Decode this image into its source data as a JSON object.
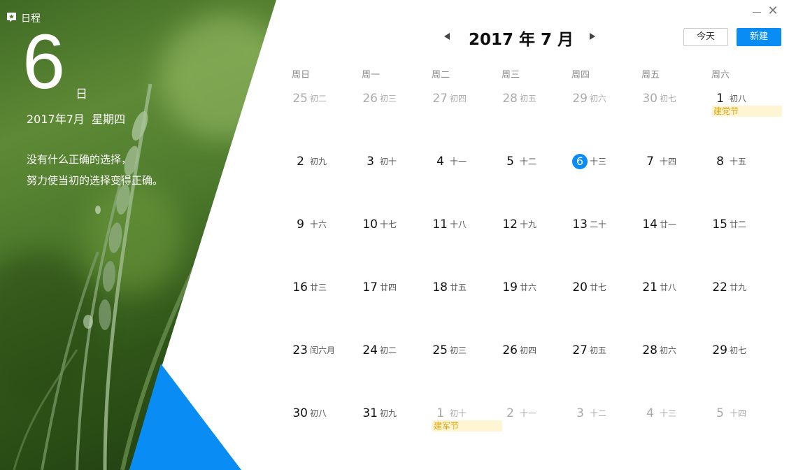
{
  "app": {
    "name": "日程",
    "logo_icon": "calendar-star-icon"
  },
  "sidebar": {
    "day": "6",
    "day_suffix": "日",
    "full_date": "2017年7月  星期四",
    "quote_line1": "没有什么正确的选择，",
    "quote_line2": "努力使当初的选择变得正确。"
  },
  "window": {
    "minimize_icon": "minimize-icon",
    "close_icon": "close-icon",
    "close_glyph": "✕"
  },
  "header": {
    "month_title": "2017 年 7 月",
    "prev_icon": "triangle-left-icon",
    "next_icon": "triangle-right-icon",
    "today_label": "今天",
    "new_label": "新建"
  },
  "weekdays": [
    "周日",
    "周一",
    "周二",
    "周三",
    "周四",
    "周五",
    "周六"
  ],
  "colors": {
    "accent": "#0a8cf5",
    "holiday_bg": "#fff5d2",
    "holiday_text": "#e4a20a",
    "muted": "#aaaaaa"
  },
  "weeks": [
    [
      {
        "day": "25",
        "lunar": "初二",
        "other": true
      },
      {
        "day": "26",
        "lunar": "初三",
        "other": true
      },
      {
        "day": "27",
        "lunar": "初四",
        "other": true
      },
      {
        "day": "28",
        "lunar": "初五",
        "other": true
      },
      {
        "day": "29",
        "lunar": "初六",
        "other": true
      },
      {
        "day": "30",
        "lunar": "初七",
        "other": true
      },
      {
        "day": "1",
        "lunar": "初八",
        "other": false,
        "holiday": "建党节"
      }
    ],
    [
      {
        "day": "2",
        "lunar": "初九",
        "other": false
      },
      {
        "day": "3",
        "lunar": "初十",
        "other": false
      },
      {
        "day": "4",
        "lunar": "十一",
        "other": false
      },
      {
        "day": "5",
        "lunar": "十二",
        "other": false
      },
      {
        "day": "6",
        "lunar": "十三",
        "other": false,
        "today": true
      },
      {
        "day": "7",
        "lunar": "十四",
        "other": false
      },
      {
        "day": "8",
        "lunar": "十五",
        "other": false
      }
    ],
    [
      {
        "day": "9",
        "lunar": "十六",
        "other": false
      },
      {
        "day": "10",
        "lunar": "十七",
        "other": false
      },
      {
        "day": "11",
        "lunar": "十八",
        "other": false
      },
      {
        "day": "12",
        "lunar": "十九",
        "other": false
      },
      {
        "day": "13",
        "lunar": "二十",
        "other": false
      },
      {
        "day": "14",
        "lunar": "廿一",
        "other": false
      },
      {
        "day": "15",
        "lunar": "廿二",
        "other": false
      }
    ],
    [
      {
        "day": "16",
        "lunar": "廿三",
        "other": false
      },
      {
        "day": "17",
        "lunar": "廿四",
        "other": false
      },
      {
        "day": "18",
        "lunar": "廿五",
        "other": false
      },
      {
        "day": "19",
        "lunar": "廿六",
        "other": false
      },
      {
        "day": "20",
        "lunar": "廿七",
        "other": false
      },
      {
        "day": "21",
        "lunar": "廿八",
        "other": false
      },
      {
        "day": "22",
        "lunar": "廿九",
        "other": false
      }
    ],
    [
      {
        "day": "23",
        "lunar": "闰六月",
        "other": false
      },
      {
        "day": "24",
        "lunar": "初二",
        "other": false
      },
      {
        "day": "25",
        "lunar": "初三",
        "other": false
      },
      {
        "day": "26",
        "lunar": "初四",
        "other": false
      },
      {
        "day": "27",
        "lunar": "初五",
        "other": false
      },
      {
        "day": "28",
        "lunar": "初六",
        "other": false
      },
      {
        "day": "29",
        "lunar": "初七",
        "other": false
      }
    ],
    [
      {
        "day": "30",
        "lunar": "初八",
        "other": false
      },
      {
        "day": "31",
        "lunar": "初九",
        "other": false
      },
      {
        "day": "1",
        "lunar": "初十",
        "other": true,
        "holiday": "建军节"
      },
      {
        "day": "2",
        "lunar": "十一",
        "other": true
      },
      {
        "day": "3",
        "lunar": "十二",
        "other": true
      },
      {
        "day": "4",
        "lunar": "十三",
        "other": true
      },
      {
        "day": "5",
        "lunar": "十四",
        "other": true
      }
    ]
  ]
}
